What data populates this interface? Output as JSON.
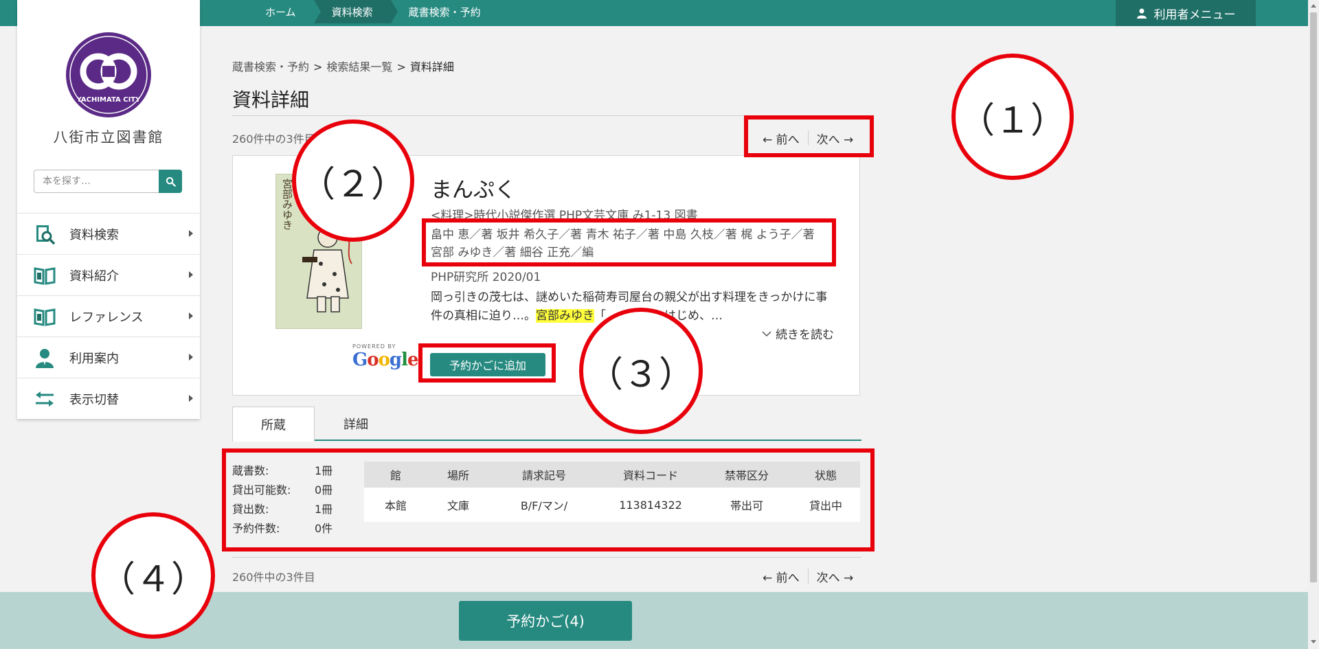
{
  "header": {
    "nav": [
      "ホーム",
      "資料検索",
      "蔵書検索・予約"
    ],
    "user_menu": "利用者メニュー"
  },
  "sidebar": {
    "logo_text": "YACHIMATA CITY",
    "library_name": "八街市立図書館",
    "search_placeholder": "本を探す…",
    "items": [
      {
        "label": "資料検索",
        "icon": "book-search-icon"
      },
      {
        "label": "資料紹介",
        "icon": "open-book-icon"
      },
      {
        "label": "レファレンス",
        "icon": "open-book-icon"
      },
      {
        "label": "利用案内",
        "icon": "person-icon"
      },
      {
        "label": "表示切替",
        "icon": "swap-arrows-icon"
      }
    ]
  },
  "breadcrumb": {
    "items": [
      "蔵書検索・予約",
      "検索結果一覧",
      "資料詳細"
    ],
    "separator": ">"
  },
  "page_title": "資料詳細",
  "result_count": "260件中の3件目",
  "pager": {
    "prev": "← 前へ",
    "next": "次へ →"
  },
  "book": {
    "cover_text": "宮部みゆき",
    "title": "まんぷく",
    "series": "<料理>時代小説傑作選 PHP文芸文庫 み1-13 図書",
    "authors": "畠中 恵／著 坂井 希久子／著 青木 祐子／著 中島 久枝／著 梶 よう子／著 宮部 みゆき／著 細谷 正充／編",
    "publisher": "PHP研究所 2020/01",
    "desc_before": "岡っ引きの茂七は、謎めいた稲荷寿司屋台の親父が出す料理をきっかけに事件の真相に迫り…。",
    "desc_highlight": "宮部みゆき",
    "desc_after": "「　　　」をはじめ、…",
    "read_more": "続きを読む",
    "powered_by": "POWERED BY",
    "google": "Google",
    "reserve_button": "予約かごに追加"
  },
  "tabs": {
    "active": "所蔵",
    "inactive": "詳細"
  },
  "stats": [
    {
      "label": "蔵書数:",
      "value": "1冊"
    },
    {
      "label": "貸出可能数:",
      "value": "0冊"
    },
    {
      "label": "貸出数:",
      "value": "1冊"
    },
    {
      "label": "予約件数:",
      "value": "0件"
    }
  ],
  "holdings": {
    "headers": [
      "館",
      "場所",
      "請求記号",
      "資料コード",
      "禁帯区分",
      "状態"
    ],
    "rows": [
      [
        "本館",
        "文庫",
        "B/F/マン/",
        "113814322",
        "帯出可",
        "貸出中"
      ]
    ]
  },
  "cart_button": "予約かご(4)",
  "annotations": [
    "（１）",
    "（２）",
    "（３）",
    "（４）"
  ],
  "colors": {
    "accent": "#268a80",
    "accent_dark": "#1f6f67",
    "annotation": "#e8000b",
    "highlight": "#ffff3c"
  }
}
